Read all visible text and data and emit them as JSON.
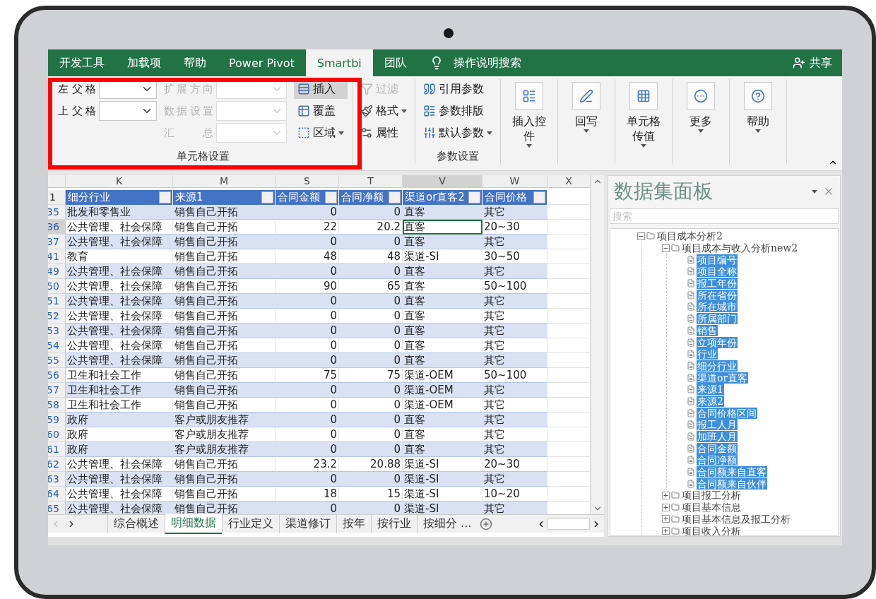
{
  "ribbon_tabs": [
    {
      "label": "开发工具",
      "selected": false
    },
    {
      "label": "加载项",
      "selected": false
    },
    {
      "label": "帮助",
      "selected": false
    },
    {
      "label": "Power Pivot",
      "selected": false
    },
    {
      "label": "Smartbi",
      "selected": true
    },
    {
      "label": "团队",
      "selected": false
    }
  ],
  "search": {
    "label": "操作说明搜索"
  },
  "share": {
    "label": "共享"
  },
  "cell_settings": {
    "label": "单元格设置",
    "parents": [
      {
        "label": "左父格",
        "disabled": false
      },
      {
        "label": "上父格",
        "disabled": false
      }
    ],
    "options": [
      {
        "label": "扩展方向",
        "disabled": true
      },
      {
        "label": "数据设置",
        "disabled": true
      },
      {
        "label": "汇 总",
        "disabled": true
      }
    ],
    "modes": [
      {
        "label": "插入",
        "selected": true,
        "dropdown": false
      },
      {
        "label": "覆盖",
        "selected": false,
        "dropdown": false
      },
      {
        "label": "区域",
        "selected": false,
        "dropdown": true
      }
    ]
  },
  "format_group": [
    {
      "label": "过滤",
      "disabled": true,
      "dropdown": false
    },
    {
      "label": "格式",
      "disabled": false,
      "dropdown": true
    },
    {
      "label": "属性",
      "disabled": false,
      "dropdown": false
    }
  ],
  "param_group": {
    "label": "参数设置",
    "buttons": [
      {
        "label": "引用参数",
        "dropdown": false
      },
      {
        "label": "参数排版",
        "dropdown": false
      },
      {
        "label": "默认参数",
        "dropdown": true
      }
    ]
  },
  "large_buttons": [
    {
      "label": "插入控件"
    },
    {
      "label": "回写"
    },
    {
      "label": "单元格传值"
    },
    {
      "label": "更多"
    },
    {
      "label": "帮助"
    }
  ],
  "sheet": {
    "columns": [
      {
        "label": "K",
        "selected": false
      },
      {
        "label": "M",
        "selected": false
      },
      {
        "label": "S",
        "selected": false
      },
      {
        "label": "T",
        "selected": false
      },
      {
        "label": "V",
        "selected": true
      },
      {
        "label": "W",
        "selected": false
      },
      {
        "label": "X",
        "selected": false
      }
    ],
    "header_row": {
      "number": "1",
      "cells": [
        "细分行业",
        "来源1",
        "合同金额",
        "合同净额",
        "渠道or直客2",
        "合同价格"
      ]
    },
    "rows": [
      {
        "number": "35",
        "selected": false,
        "cells": [
          "批发和零售业",
          "销售自己开拓",
          "0",
          "0",
          "直客",
          "其它"
        ]
      },
      {
        "number": "36",
        "selected": true,
        "cells": [
          "公共管理、社会保障",
          "销售自己开拓",
          "22",
          "20.2",
          "直客",
          "20~30"
        ]
      },
      {
        "number": "37",
        "selected": false,
        "cells": [
          "公共管理、社会保障",
          "销售自己开拓",
          "0",
          "0",
          "直客",
          "其它"
        ]
      },
      {
        "number": "41",
        "selected": false,
        "cells": [
          "教育",
          "销售自己开拓",
          "48",
          "48",
          "渠道-SI",
          "30~50"
        ]
      },
      {
        "number": "49",
        "selected": false,
        "cells": [
          "公共管理、社会保障",
          "销售自己开拓",
          "0",
          "0",
          "直客",
          "其它"
        ]
      },
      {
        "number": "50",
        "selected": false,
        "cells": [
          "公共管理、社会保障",
          "销售自己开拓",
          "90",
          "65",
          "直客",
          "50~100"
        ]
      },
      {
        "number": "51",
        "selected": false,
        "cells": [
          "公共管理、社会保障",
          "销售自己开拓",
          "0",
          "0",
          "直客",
          "其它"
        ]
      },
      {
        "number": "52",
        "selected": false,
        "cells": [
          "公共管理、社会保障",
          "销售自己开拓",
          "0",
          "0",
          "直客",
          "其它"
        ]
      },
      {
        "number": "53",
        "selected": false,
        "cells": [
          "公共管理、社会保障",
          "销售自己开拓",
          "0",
          "0",
          "直客",
          "其它"
        ]
      },
      {
        "number": "54",
        "selected": false,
        "cells": [
          "公共管理、社会保障",
          "销售自己开拓",
          "0",
          "0",
          "直客",
          "其它"
        ]
      },
      {
        "number": "55",
        "selected": false,
        "cells": [
          "公共管理、社会保障",
          "销售自己开拓",
          "0",
          "0",
          "直客",
          "其它"
        ]
      },
      {
        "number": "56",
        "selected": false,
        "cells": [
          "卫生和社会工作",
          "销售自己开拓",
          "75",
          "75",
          "渠道-OEM",
          "50~100"
        ]
      },
      {
        "number": "57",
        "selected": false,
        "cells": [
          "卫生和社会工作",
          "销售自己开拓",
          "0",
          "0",
          "渠道-OEM",
          "其它"
        ]
      },
      {
        "number": "58",
        "selected": false,
        "cells": [
          "卫生和社会工作",
          "销售自己开拓",
          "0",
          "0",
          "渠道-OEM",
          "其它"
        ]
      },
      {
        "number": "59",
        "selected": false,
        "cells": [
          "政府",
          "客户或朋友推荐",
          "0",
          "0",
          "直客",
          "其它"
        ]
      },
      {
        "number": "60",
        "selected": false,
        "cells": [
          "政府",
          "客户或朋友推荐",
          "0",
          "0",
          "直客",
          "其它"
        ]
      },
      {
        "number": "61",
        "selected": false,
        "cells": [
          "政府",
          "客户或朋友推荐",
          "0",
          "0",
          "直客",
          "其它"
        ]
      },
      {
        "number": "62",
        "selected": false,
        "cells": [
          "公共管理、社会保障",
          "销售自己开拓",
          "23.2",
          "20.88",
          "渠道-SI",
          "20~30"
        ]
      },
      {
        "number": "63",
        "selected": false,
        "cells": [
          "公共管理、社会保障",
          "销售自己开拓",
          "0",
          "0",
          "渠道-SI",
          "其它"
        ]
      },
      {
        "number": "64",
        "selected": false,
        "cells": [
          "公共管理、社会保障",
          "销售自己开拓",
          "18",
          "15",
          "渠道-SI",
          "10~20"
        ]
      },
      {
        "number": "65",
        "selected": false,
        "cells": [
          "公共管理、社会保障",
          "销售自己开拓",
          "0",
          "0",
          "渠道-SI",
          "其它"
        ]
      }
    ]
  },
  "sheet_tabs": [
    {
      "label": "综合概述",
      "selected": false
    },
    {
      "label": "明细数据",
      "selected": true
    },
    {
      "label": "行业定义",
      "selected": false
    },
    {
      "label": "渠道修订",
      "selected": false
    },
    {
      "label": "按年",
      "selected": false
    },
    {
      "label": "按行业",
      "selected": false
    },
    {
      "label": "按细分 ...",
      "selected": false
    }
  ],
  "panel": {
    "title": "数据集面板",
    "search": {
      "placeholder": "搜索"
    },
    "tree": [
      {
        "label": "项目成本分析2",
        "expanded": true,
        "children": [
          {
            "label": "项目成本与收入分析new2",
            "expanded": true,
            "children": [
              {
                "label": "项目编号",
                "selected": true
              },
              {
                "label": "项目全称",
                "selected": true
              },
              {
                "label": "报工年份",
                "selected": true
              },
              {
                "label": "所在省份",
                "selected": true
              },
              {
                "label": "所在城市",
                "selected": true
              },
              {
                "label": "所属部门",
                "selected": true
              },
              {
                "label": "销售",
                "selected": true
              },
              {
                "label": "立项年份",
                "selected": true
              },
              {
                "label": "行业",
                "selected": true
              },
              {
                "label": "细分行业",
                "selected": true
              },
              {
                "label": "渠道or直客",
                "selected": true
              },
              {
                "label": "来源1",
                "selected": true
              },
              {
                "label": "来源2",
                "selected": true
              },
              {
                "label": "合同价格区间",
                "selected": true
              },
              {
                "label": "报工人月",
                "selected": true
              },
              {
                "label": "加班人月",
                "selected": true
              },
              {
                "label": "合同金额",
                "selected": true
              },
              {
                "label": "合同净额",
                "selected": true
              },
              {
                "label": "合同额来自直客",
                "selected": true
              },
              {
                "label": "合同额来自伙伴",
                "selected": true
              }
            ]
          },
          {
            "label": "项目报工分析",
            "expanded": false
          },
          {
            "label": "项目基本信息",
            "expanded": false
          },
          {
            "label": "项目基本信息及报工分析",
            "expanded": false
          },
          {
            "label": "项目收入分析",
            "expanded": false
          }
        ]
      }
    ]
  }
}
